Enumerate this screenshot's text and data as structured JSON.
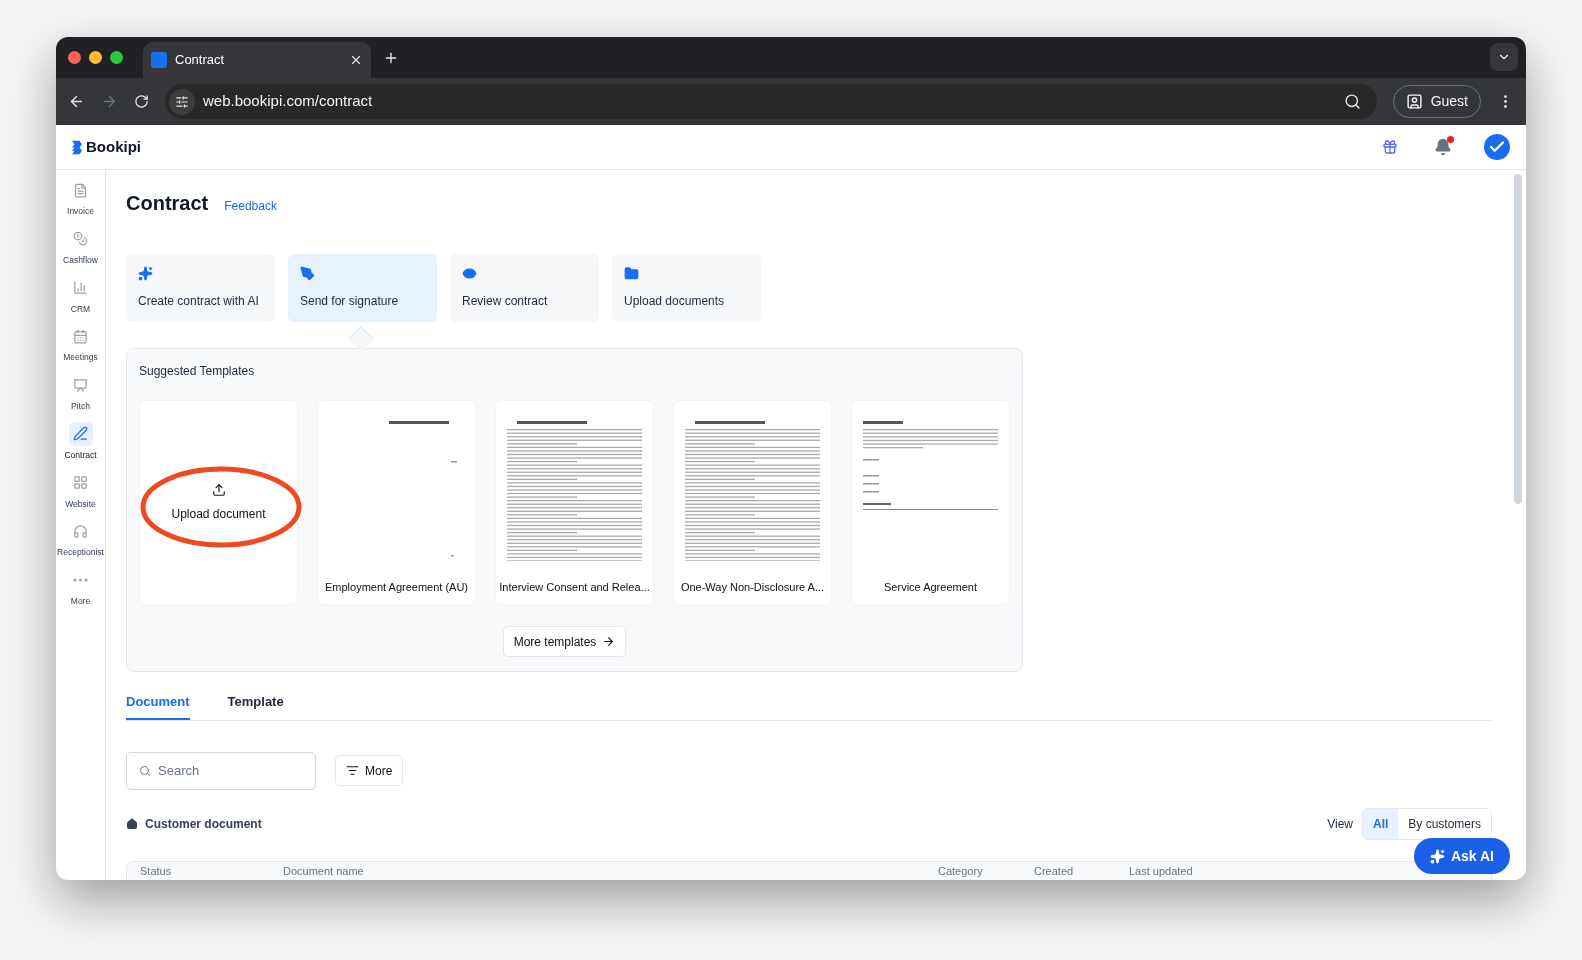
{
  "browser": {
    "tab_title": "Contract",
    "url": "web.bookipi.com/contract",
    "profile": "Guest"
  },
  "header": {
    "logo": "Bookipi",
    "notification_unread": true
  },
  "sidebar": {
    "items": [
      {
        "label": "Invoice",
        "selected": false
      },
      {
        "label": "Cashflow",
        "selected": false
      },
      {
        "label": "CRM",
        "selected": false
      },
      {
        "label": "Meetings",
        "selected": false
      },
      {
        "label": "Pitch",
        "selected": false
      },
      {
        "label": "Contract",
        "selected": true
      },
      {
        "label": "Website",
        "selected": false
      },
      {
        "label": "Receptionist",
        "selected": false
      },
      {
        "label": "More",
        "selected": false
      }
    ]
  },
  "page": {
    "title": "Contract",
    "feedback": "Feedback"
  },
  "actions": [
    {
      "label": "Create contract with AI",
      "selected": false
    },
    {
      "label": "Send for signature",
      "selected": true
    },
    {
      "label": "Review contract",
      "selected": false
    },
    {
      "label": "Upload documents",
      "selected": false
    }
  ],
  "suggested": {
    "title": "Suggested Templates",
    "templates": [
      {
        "kind": "upload",
        "label": "Upload document"
      },
      {
        "kind": "template",
        "label": "Employment Agreement (AU)"
      },
      {
        "kind": "template",
        "label": "Interview Consent and Relea..."
      },
      {
        "kind": "template",
        "label": "One-Way Non-Disclosure A..."
      },
      {
        "kind": "template",
        "label": "Service Agreement"
      }
    ],
    "more_button": "More templates"
  },
  "tabs": [
    {
      "label": "Document",
      "selected": true
    },
    {
      "label": "Template",
      "selected": false
    }
  ],
  "search": {
    "placeholder": "Search"
  },
  "more_filter": "More",
  "section": {
    "title": "Customer document",
    "view_label": "View",
    "view_options": [
      {
        "label": "All",
        "selected": true
      },
      {
        "label": "By customers",
        "selected": false
      }
    ]
  },
  "table": {
    "columns": [
      "Status",
      "Document name",
      "Category",
      "Created",
      "Last updated"
    ]
  },
  "ask_ai": "Ask AI"
}
